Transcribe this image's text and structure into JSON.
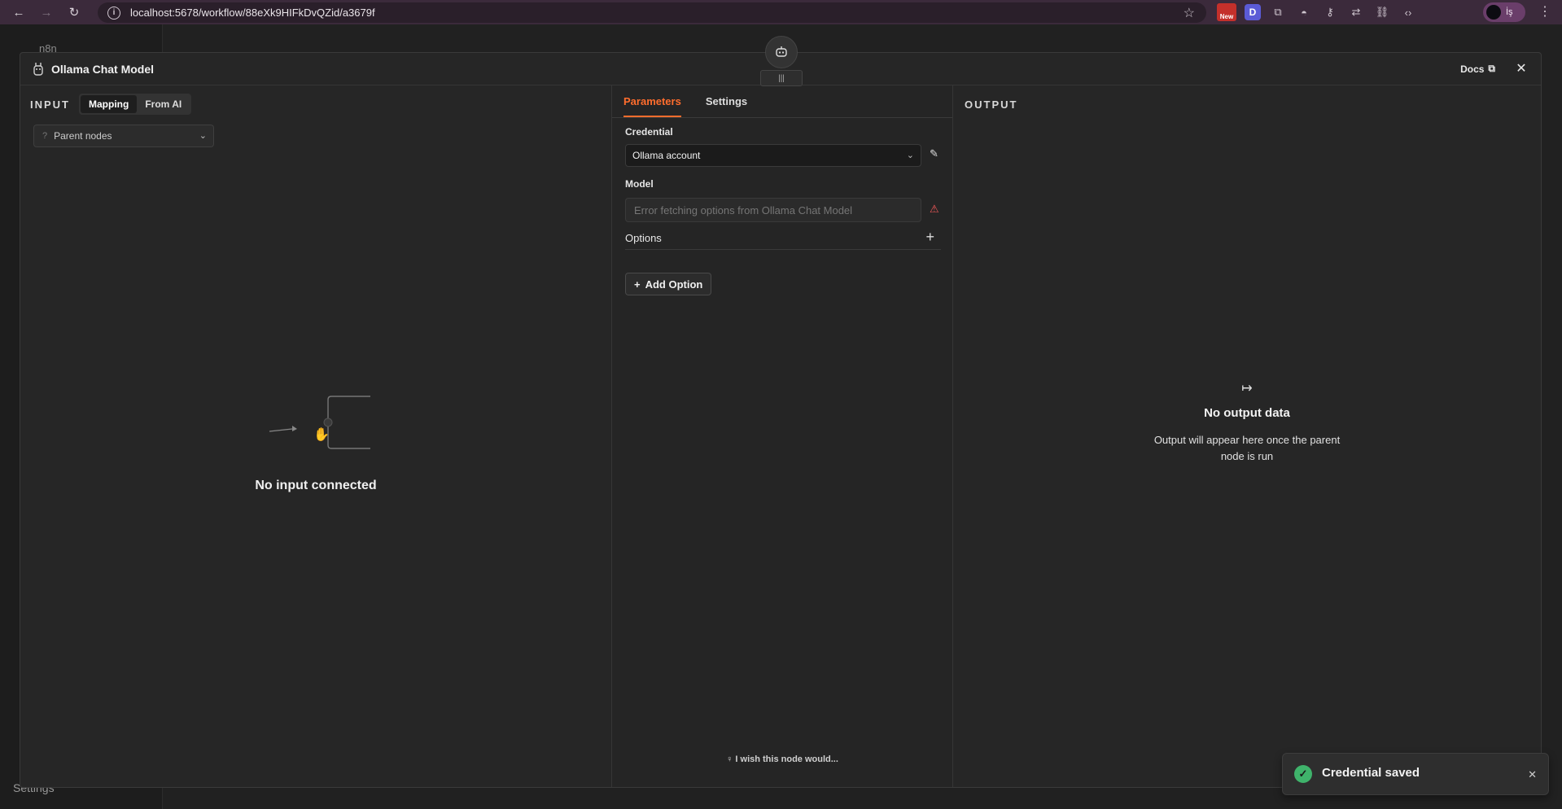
{
  "browser": {
    "url": "localhost:5678/workflow/88eXk9HIFkDvQZid/a3679f",
    "profile_initial": "İş"
  },
  "background": {
    "app_name": "n8n",
    "settings_label": "Settings"
  },
  "modal": {
    "title": "Ollama Chat Model",
    "docs_label": "Docs"
  },
  "input": {
    "label": "INPUT",
    "mode_tabs": [
      "Mapping",
      "From AI"
    ],
    "parent_select": "Parent nodes",
    "empty_message": "No input connected"
  },
  "params": {
    "tabs": [
      "Parameters",
      "Settings"
    ],
    "credential_label": "Credential",
    "credential_value": "Ollama account",
    "model_label": "Model",
    "model_placeholder": "Error fetching options from Ollama Chat Model",
    "options_label": "Options",
    "add_option": "Add Option",
    "wish": "I wish this node would..."
  },
  "output": {
    "label": "OUTPUT",
    "empty_title": "No output data",
    "empty_desc": "Output will appear here once the parent node is run"
  },
  "toast": {
    "message": "Credential saved"
  },
  "colors": {
    "accent": "#ff6d2d",
    "success": "#3fb36b",
    "warning": "#f45959"
  }
}
